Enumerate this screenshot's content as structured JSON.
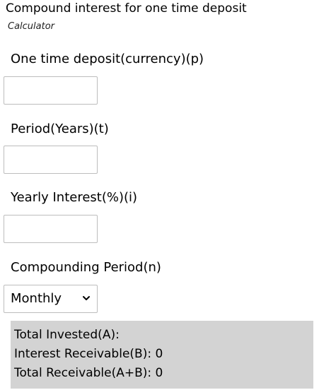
{
  "header": {
    "title": "Compound interest for one time deposit",
    "subtitle": "Calculator"
  },
  "form": {
    "deposit": {
      "label": "One time deposit(currency)(p)",
      "value": ""
    },
    "period": {
      "label": "Period(Years)(t)",
      "value": ""
    },
    "interest": {
      "label": "Yearly Interest(%)(i)",
      "value": ""
    },
    "compounding": {
      "label": "Compounding Period(n)",
      "selected": "Monthly",
      "icon": "chevron-down-icon"
    }
  },
  "results": {
    "total_invested": "Total Invested(A):",
    "interest_receivable": "Interest Receivable(B): 0",
    "total_receivable": "Total Receivable(A+B): 0"
  },
  "colors": {
    "results_background": "#d3d3d3",
    "input_border": "#bdbdbd"
  }
}
